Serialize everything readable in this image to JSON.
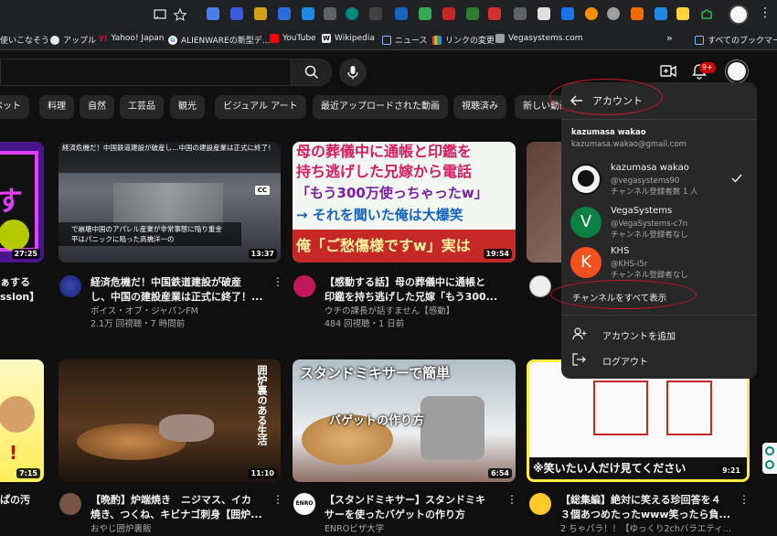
{
  "browser": {
    "bookmarks": [
      {
        "label": "使いこなそう",
        "color": "#4285f4"
      },
      {
        "label": "アップル",
        "color": "#e8eaed"
      },
      {
        "label": "Yahoo! Japan",
        "color": "#ff0033"
      },
      {
        "label": "ALIENWAREの新型デ...",
        "color": "#4285f4"
      },
      {
        "label": "YouTube",
        "color": "#ff0000"
      },
      {
        "label": "Wikipedia",
        "color": "#e8eaed"
      },
      {
        "label": "ニュース",
        "color": "#8ab4f8"
      },
      {
        "label": "リンクの変更",
        "color": "#fbbc04"
      },
      {
        "label": "Vegasystems.com",
        "color": "#9aa0a6"
      }
    ],
    "more_bookmarks": "»",
    "all_bookmarks": "すべてのブックマーク"
  },
  "header": {
    "search_placeholder": "",
    "notification_count": "9+"
  },
  "chips": [
    "ペット",
    "料理",
    "自然",
    "工芸品",
    "観光",
    "ビジュアル アート",
    "最近アップロードされた動画",
    "視聴済み",
    "新しい動画"
  ],
  "row1": [
    {
      "duration": "27:25",
      "title_line1": "ぁする",
      "title_line2": "ssion】",
      "channel": "",
      "stats": ""
    },
    {
      "duration": "13:37",
      "title_line1": "経済危機だ！中国鉄道建設が破産",
      "title_line2": "し、中国の建設産業は正式に終了！...",
      "channel": "ボイス・オブ・ジャパンFM",
      "stats": "2.1万 回視聴・7 時間前",
      "thumb_text1": "経済危機だ！中国鉄道建設が破産し…中国の建設産業は正式に終了！",
      "thumb_text2": "で崩壊中国のアパレル産業が非常事態に陥り重金平はパニックに陥った高橋洋一の",
      "cc": "CC"
    },
    {
      "duration": "19:54",
      "title_line1": "【感動する話】母の葬儀中に通帳と",
      "title_line2": "印鑑を持ち逃げした兄嫁「もう300...",
      "channel": "ウチの課長が話すません【感動】",
      "stats": "484 回視聴・1 日前",
      "thumb_lines": [
        "母の葬儀中に通帳と印鑑を",
        "持ち逃げした兄嫁から電話",
        "「もう300万使っちゃったw」",
        "→ それを聞いた俺は大爆笑",
        "俺「ご愁傷様ですw」実は"
      ]
    },
    {
      "duration": "",
      "title_line1": "",
      "title_line2": "",
      "channel": "",
      "stats": ""
    }
  ],
  "row2": [
    {
      "duration": "7:15",
      "title_line1": "ぱの汚",
      "title_line2": "",
      "channel": "",
      "stats": ""
    },
    {
      "duration": "11:10",
      "title_line1": "【晩酌】炉端焼き　ニジマス、イカ",
      "title_line2": "焼き、つくね、キビナゴ刺身【囲炉...",
      "channel": "おやじ囲炉裏飯",
      "stats": "",
      "thumb_text": "囲炉裏のある生活"
    },
    {
      "duration": "6:54",
      "title_line1": "【スタンドミキサー】スタンドミキ",
      "title_line2": "サーを使ったバゲットの作り方",
      "channel": "ENROビザ大学",
      "stats": "",
      "thumb_text1": "スタンドミキサーで簡単",
      "thumb_text2": "バゲットの作り方",
      "avatar_text": "ENRO"
    },
    {
      "duration": "9:21",
      "title_line1": "【総集編】絶対に笑える珍回答を４",
      "title_line2": "３個あつめたったwww笑ったら負...",
      "channel": "2 ちゃパラ！！【ゆっくり2chバラエティ...",
      "stats": "",
      "thumb_text": "※笑いたい人だけ見てください"
    }
  ],
  "account_panel": {
    "back_label": "アカウント",
    "user_name": "kazumasa wakao",
    "user_email": "kazumasa.wakao@gmail.com",
    "accounts": [
      {
        "name": "kazumasa wakao",
        "handle": "@vegasystems90",
        "subs": "チャンネル登録者数 1 人",
        "initial": "",
        "color": "#f2f2f2",
        "selected": true
      },
      {
        "name": "VegaSystems",
        "handle": "@VegaSystems-c7n",
        "subs": "チャンネル登録者なし",
        "initial": "V",
        "color": "#0b8043",
        "selected": false
      },
      {
        "name": "KHS",
        "handle": "@KHS-i5r",
        "subs": "チャンネル登録者なし",
        "initial": "K",
        "color": "#f4511e",
        "selected": false
      }
    ],
    "show_all": "チャンネルをすべて表示",
    "add_account": "アカウントを追加",
    "logout": "ログアウト"
  }
}
